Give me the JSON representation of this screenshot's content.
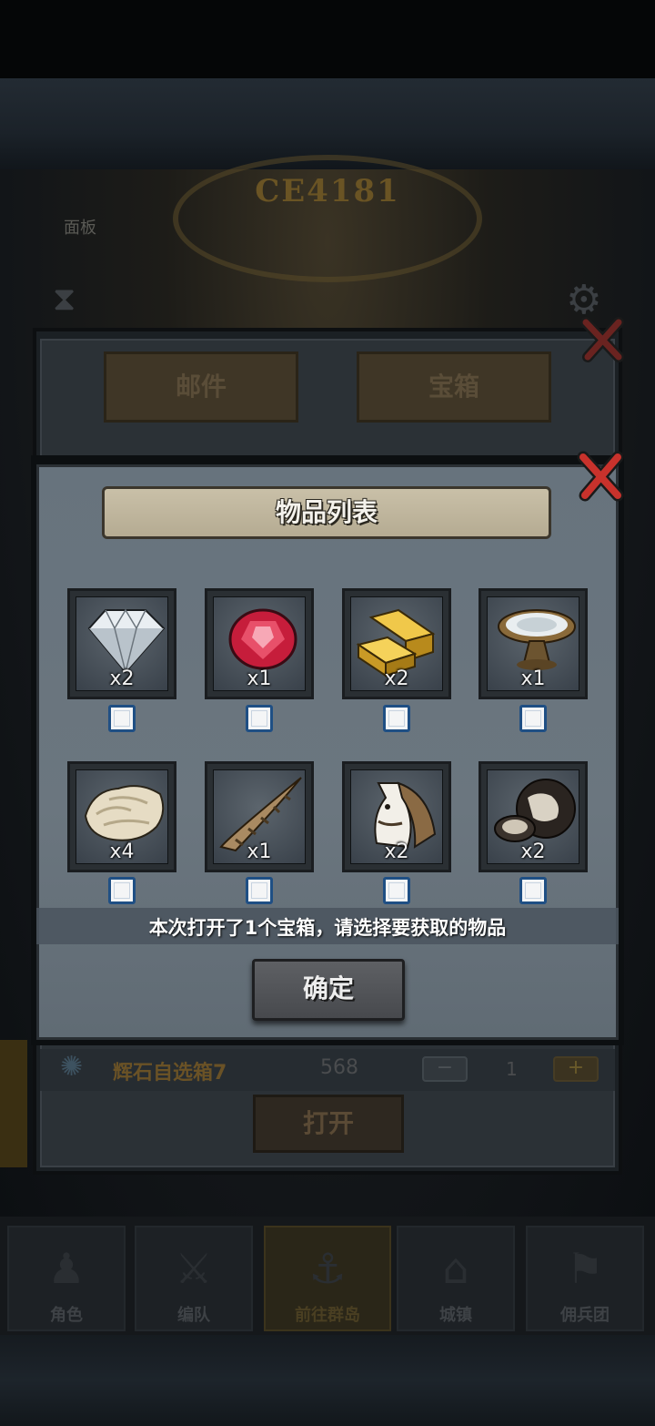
{
  "background": {
    "code": "CE4181",
    "left_label": "面板",
    "hourglass_icon": "hourglass-icon",
    "gear_icon": "gear-icon"
  },
  "mail_window": {
    "tabs": [
      {
        "label": "邮件"
      },
      {
        "label": "宝箱"
      }
    ],
    "row": {
      "icon": "swirl-icon",
      "name": "辉石自选箱7",
      "count": "568",
      "quantity": "1",
      "minus": "−",
      "plus": "+"
    },
    "open_label": "打开"
  },
  "dialog": {
    "title": "物品列表",
    "items": [
      {
        "icon": "diamond-icon",
        "count": "x2"
      },
      {
        "icon": "ruby-icon",
        "count": "x1"
      },
      {
        "icon": "gold-bar-icon",
        "count": "x2"
      },
      {
        "icon": "silver-dish-icon",
        "count": "x1"
      },
      {
        "icon": "fleece-icon",
        "count": "x4"
      },
      {
        "icon": "horn-icon",
        "count": "x1"
      },
      {
        "icon": "horse-icon",
        "count": "x2"
      },
      {
        "icon": "truffle-icon",
        "count": "x2"
      }
    ],
    "notice": "本次打开了1个宝箱，请选择要获取的物品",
    "confirm_label": "确定"
  },
  "nav": {
    "tabs": [
      {
        "label": "角色",
        "glyph": "♟"
      },
      {
        "label": "编队",
        "glyph": "⚔"
      },
      {
        "label": "前往群岛",
        "glyph": "⚓"
      },
      {
        "label": "城镇",
        "glyph": "⌂"
      },
      {
        "label": "佣兵团",
        "glyph": "⚑"
      }
    ]
  },
  "colors": {
    "accent_red": "#c8322c",
    "checkbox_border": "#1f4f84",
    "dialog_bg": "#67737d"
  }
}
